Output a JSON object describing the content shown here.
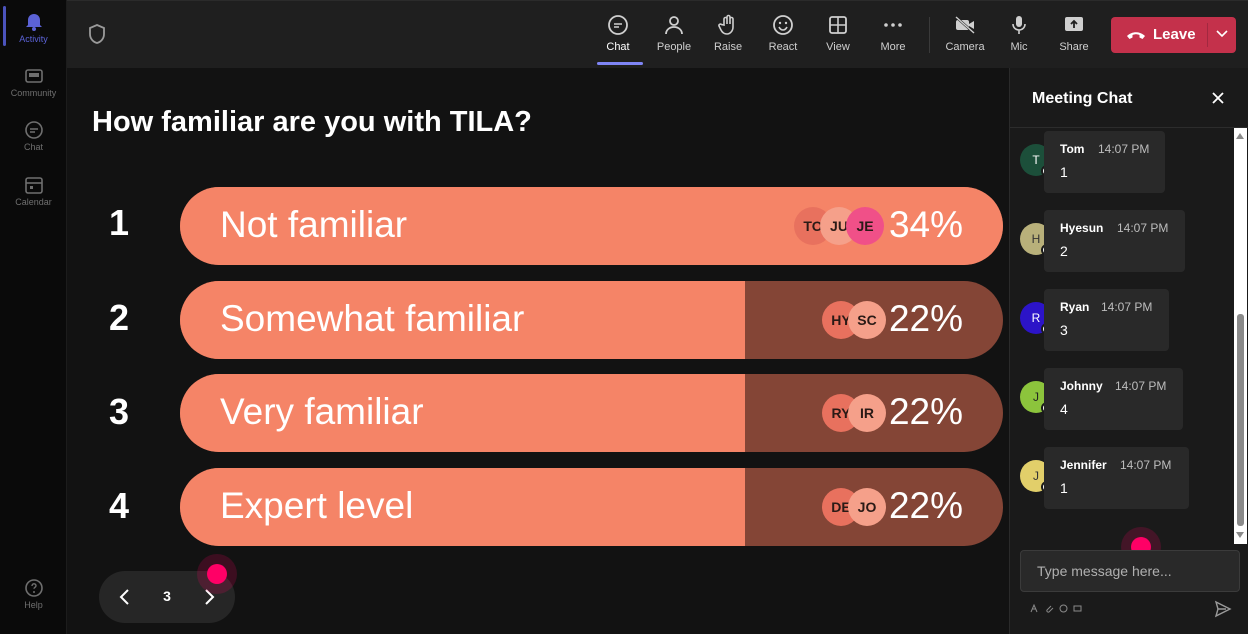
{
  "rail": {
    "items": [
      {
        "label": "Activity",
        "icon": "bell-icon",
        "active": true
      },
      {
        "label": "Community",
        "icon": "community-icon"
      },
      {
        "label": "Chat",
        "icon": "chat-icon"
      },
      {
        "label": "Calendar",
        "icon": "calendar-icon"
      }
    ],
    "help_label": "Help"
  },
  "toolbar": {
    "chat_label": "Chat",
    "people_label": "People",
    "raise_label": "Raise",
    "react_label": "React",
    "view_label": "View",
    "more_label": "More",
    "camera_label": "Camera",
    "mic_label": "Mic",
    "share_label": "Share",
    "leave_label": "Leave",
    "active_tab": "Chat"
  },
  "poll": {
    "question": "How familiar are you with TILA?",
    "options": [
      {
        "num": "1",
        "label": "Not familiar",
        "percent": "34%",
        "fill_fraction": 1.0,
        "voters": [
          "TO",
          "JU",
          "JE"
        ]
      },
      {
        "num": "2",
        "label": "Somewhat familiar",
        "percent": "22%",
        "fill_fraction": 0.686,
        "voters": [
          "HY",
          "SC"
        ]
      },
      {
        "num": "3",
        "label": "Very familiar",
        "percent": "22%",
        "fill_fraction": 0.686,
        "voters": [
          "RY",
          "IR"
        ]
      },
      {
        "num": "4",
        "label": "Expert level",
        "percent": "22%",
        "fill_fraction": 0.686,
        "voters": [
          "DE",
          "JO"
        ]
      }
    ],
    "colors": {
      "bar_fill": "#f58467",
      "bar_track": "#844536"
    }
  },
  "pager": {
    "page": "3"
  },
  "chat": {
    "title": "Meeting Chat",
    "messages": [
      {
        "initial": "T",
        "name": "Tom",
        "time": "14:07 PM",
        "text": "1",
        "color": "#1c4f3a"
      },
      {
        "initial": "H",
        "name": "Hyesun",
        "time": "14:07 PM",
        "text": "2",
        "color": "#b8b07a"
      },
      {
        "initial": "R",
        "name": "Ryan",
        "time": "14:07 PM",
        "text": "3",
        "color": "#2c14c8"
      },
      {
        "initial": "J",
        "name": "Johnny",
        "time": "14:07 PM",
        "text": "4",
        "color": "#8cc43c"
      },
      {
        "initial": "J",
        "name": "Jennifer",
        "time": "14:07 PM",
        "text": "1",
        "color": "#e2cf6a"
      }
    ],
    "compose_placeholder": "Type message here..."
  }
}
